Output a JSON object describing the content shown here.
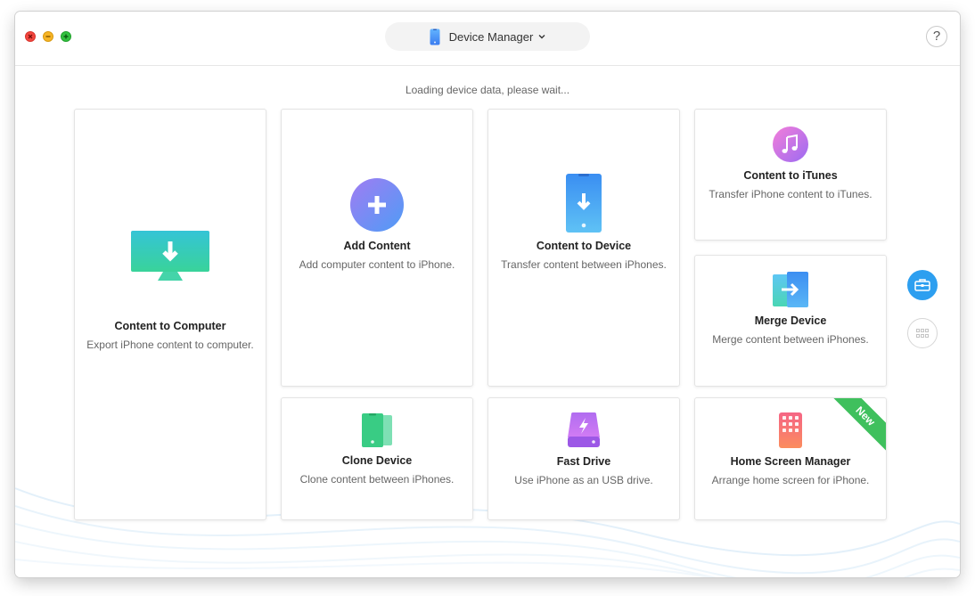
{
  "titlebar": {
    "device_selector": {
      "label": "Device Manager",
      "icon": "phone-icon"
    },
    "help_label": "?"
  },
  "main": {
    "status_text": "Loading device data, please wait...",
    "cards": [
      {
        "id": "content-to-computer",
        "title": "Content to Computer",
        "desc": "Export iPhone content to computer.",
        "icon": "monitor-download-icon"
      },
      {
        "id": "add-content",
        "title": "Add Content",
        "desc": "Add computer content to iPhone.",
        "icon": "plus-circle-icon"
      },
      {
        "id": "content-to-device",
        "title": "Content to Device",
        "desc": "Transfer content between iPhones.",
        "icon": "phone-download-icon"
      },
      {
        "id": "content-to-itunes",
        "title": "Content to iTunes",
        "desc": "Transfer iPhone content to iTunes.",
        "icon": "music-note-icon"
      },
      {
        "id": "merge-device",
        "title": "Merge Device",
        "desc": "Merge content between iPhones.",
        "icon": "merge-phones-icon"
      },
      {
        "id": "clone-device",
        "title": "Clone Device",
        "desc": "Clone content between iPhones.",
        "icon": "clone-phones-icon"
      },
      {
        "id": "fast-drive",
        "title": "Fast Drive",
        "desc": "Use iPhone as an USB drive.",
        "icon": "usb-drive-icon"
      },
      {
        "id": "home-screen-manager",
        "title": "Home Screen Manager",
        "desc": "Arrange home screen for iPhone.",
        "icon": "home-screen-icon",
        "badge": "New"
      }
    ]
  },
  "sidebar": {
    "buttons": [
      {
        "icon": "toolbox-icon",
        "active": true
      },
      {
        "icon": "grid-icon",
        "active": false
      }
    ]
  },
  "colors": {
    "accent": "#2d9ff0",
    "badge": "#3fc05d"
  }
}
